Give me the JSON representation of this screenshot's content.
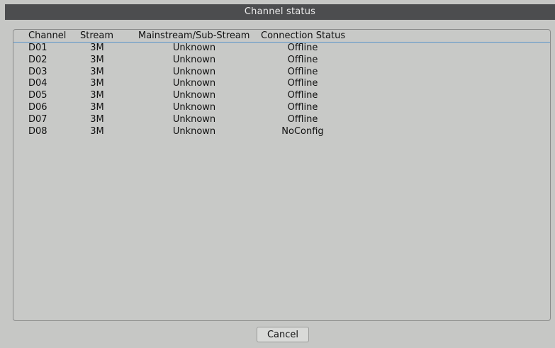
{
  "window": {
    "title": "Channel status"
  },
  "table": {
    "headers": {
      "channel": "Channel",
      "stream": "Stream",
      "mainstream": "Mainstream/Sub-Stream",
      "connection": "Connection Status"
    },
    "rows": [
      {
        "channel": "D01",
        "stream": "3M",
        "mainstream": "Unknown",
        "connection": "Offline"
      },
      {
        "channel": "D02",
        "stream": "3M",
        "mainstream": "Unknown",
        "connection": "Offline"
      },
      {
        "channel": "D03",
        "stream": "3M",
        "mainstream": "Unknown",
        "connection": "Offline"
      },
      {
        "channel": "D04",
        "stream": "3M",
        "mainstream": "Unknown",
        "connection": "Offline"
      },
      {
        "channel": "D05",
        "stream": "3M",
        "mainstream": "Unknown",
        "connection": "Offline"
      },
      {
        "channel": "D06",
        "stream": "3M",
        "mainstream": "Unknown",
        "connection": "Offline"
      },
      {
        "channel": "D07",
        "stream": "3M",
        "mainstream": "Unknown",
        "connection": "Offline"
      },
      {
        "channel": "D08",
        "stream": "3M",
        "mainstream": "Unknown",
        "connection": "NoConfig"
      }
    ]
  },
  "footer": {
    "cancel_label": "Cancel"
  },
  "colors": {
    "background": "#c6c7c5",
    "titlebar": "#4c4d4f",
    "header_rule": "#5b94c9"
  }
}
